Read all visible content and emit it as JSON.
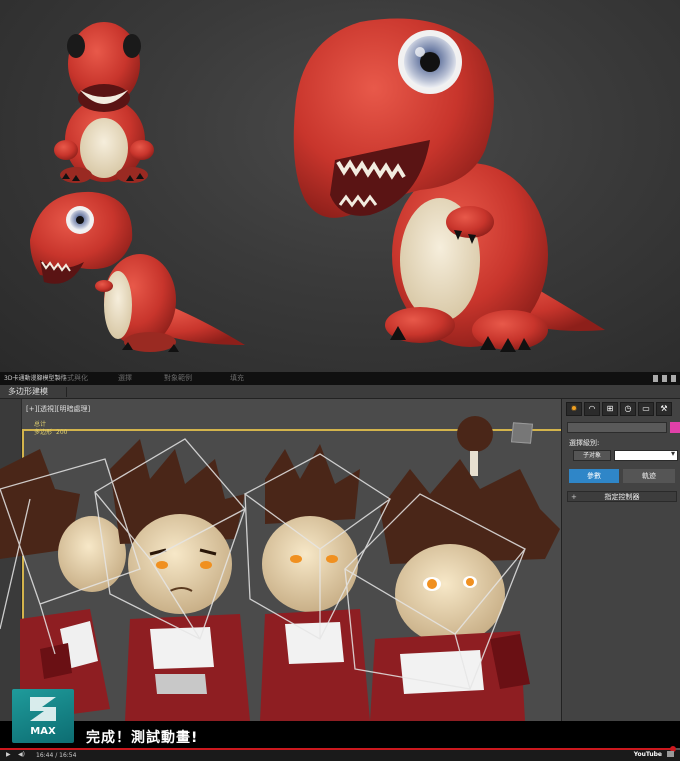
{
  "window": {
    "title": "3D卡通動漫腳模型製作",
    "menu": [
      "格式與化",
      "選擇",
      "對象範例",
      "填充"
    ]
  },
  "ribbon": {
    "tab_label": "多边形建模"
  },
  "viewport": {
    "label": "[+][透視][明暗處理]",
    "stats_label": "总计",
    "stats_sub_label": "多边形",
    "stats_value": "200"
  },
  "command_panel": {
    "selection_label": "選擇級別:",
    "subobject_button": "子对象",
    "tab_params": "參數",
    "tab_track": "軌迹",
    "assign_controller": "指定控制器",
    "assign_controller_plus": "+",
    "color_swatch": "#e040a8"
  },
  "overlay": {
    "brand": "MAX",
    "subtitle": "完成！測試動畫!"
  },
  "player": {
    "time": "16:44 / 16:54",
    "progress": 0.99,
    "logo": "YouTube"
  },
  "colors": {
    "accent_active": "#2f86c8",
    "viewport_border": "#d3b44c",
    "progress": "#cc181e"
  }
}
